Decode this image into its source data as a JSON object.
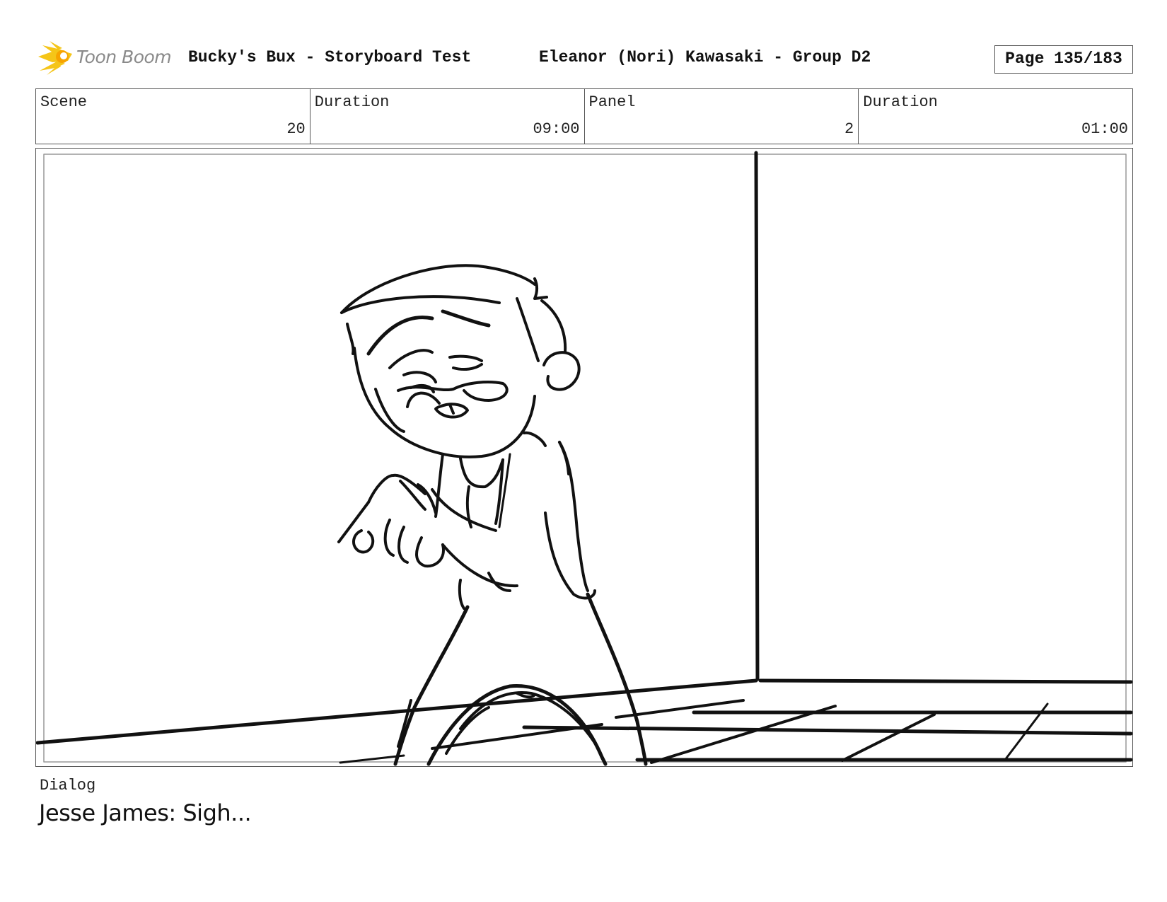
{
  "header": {
    "logo_text": "Toon Boom",
    "project_title": "Bucky's Bux - Storyboard Test",
    "author": "Eleanor (Nori) Kawasaki - Group D2",
    "page": "Page 135/183"
  },
  "info": {
    "scene_label": "Scene",
    "scene_value": "20",
    "scene_duration_label": "Duration",
    "scene_duration_value": "09:00",
    "panel_label": "Panel",
    "panel_value": "2",
    "panel_duration_label": "Duration",
    "panel_duration_value": "01:00"
  },
  "dialog": {
    "label": "Dialog",
    "text": "Jesse James: Sigh..."
  },
  "colors": {
    "logo_flame": "#f5c518",
    "logo_text": "#8a8a8a",
    "border": "#555555"
  },
  "icons": {
    "logo": "toon-boom-flame-icon"
  }
}
